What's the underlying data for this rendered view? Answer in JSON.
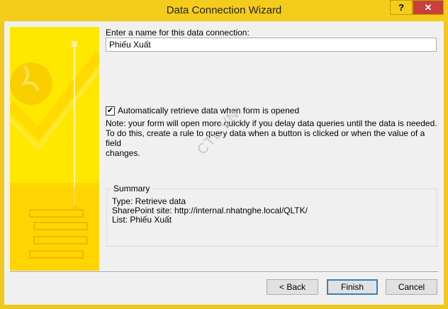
{
  "window": {
    "title": "Data Connection Wizard",
    "help_label": "?",
    "close_label": "✕"
  },
  "form": {
    "name_label": "Enter a name for this data connection:",
    "name_value": "Phiếu Xuất",
    "auto_retrieve_label": "Automatically retrieve data when form is opened",
    "auto_retrieve_checked": true,
    "note_lines": [
      "Note: your form will open more quickly if you delay data queries until the data is needed.",
      "To do this, create a rule to query data when a button is clicked or when the value of a field",
      "changes."
    ]
  },
  "watermark": "CTL.VN",
  "summary": {
    "title": "Summary",
    "lines": [
      "Type: Retrieve data",
      "SharePoint site: http://internal.nhatnghe.local/QLTK/",
      "List: Phiếu Xuất"
    ]
  },
  "buttons": {
    "back": "< Back",
    "finish": "Finish",
    "cancel": "Cancel"
  },
  "colors": {
    "titlebar": "#f4cc1c",
    "art_yellow": "#fcd900",
    "close": "#c7413a",
    "default_button_border": "#3c7fb1"
  }
}
